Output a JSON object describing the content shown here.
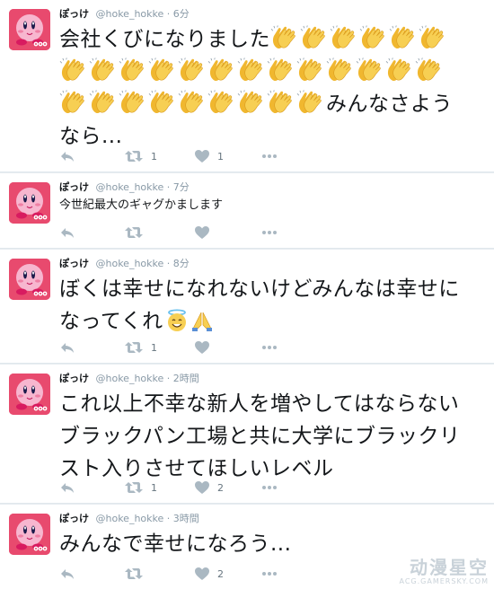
{
  "tweets": [
    {
      "name": "ぽっけ",
      "handle": "@hoke_hokke",
      "sep": "·",
      "time": "6分",
      "text_lead": "会社くびになりました",
      "text_tail": "みんなさよう",
      "text_last": "なら...",
      "retweets": "1",
      "likes": "1"
    },
    {
      "name": "ぽっけ",
      "handle": "@hoke_hokke",
      "sep": "·",
      "time": "7分",
      "text": "今世紀最大のギャグかまします",
      "retweets": "",
      "likes": ""
    },
    {
      "name": "ぽっけ",
      "handle": "@hoke_hokke",
      "sep": "·",
      "time": "8分",
      "line1": "ぼくは幸せになれないけどみんなは幸せに",
      "line2": "なってくれ",
      "retweets": "1",
      "likes": ""
    },
    {
      "name": "ぽっけ",
      "handle": "@hoke_hokke",
      "sep": "·",
      "time": "2時間",
      "line1": "これ以上不幸な新人を増やしてはならない",
      "line2": "ブラックパン工場と共に大学にブラックリ",
      "line3": "スト入りさせてほしいレベル",
      "retweets": "1",
      "likes": "2"
    },
    {
      "name": "ぽっけ",
      "handle": "@hoke_hokke",
      "sep": "·",
      "time": "3時間",
      "text": "みんなで幸せになろう...",
      "retweets": "",
      "likes": "2"
    }
  ],
  "icons": {
    "avatar": "kirby-avatar",
    "reply": "reply-icon",
    "retweet": "retweet-icon",
    "like": "heart-icon",
    "more": "more-icon",
    "clap": "clapping-hands-emoji",
    "halo": "smiling-face-with-halo-emoji",
    "pray": "folded-hands-emoji"
  },
  "colors": {
    "background": "#e6ecf0",
    "card": "#ffffff",
    "text": "#14171a",
    "muted": "#8899a6",
    "icon": "#aab8c2",
    "avatar_bg": "#e84a6e",
    "kirby_pink": "#f7b6cf",
    "clap_yellow": "#f5c542"
  },
  "watermark": {
    "main": "动漫星空",
    "sub": "ACG.GAMERSKY.COM"
  }
}
